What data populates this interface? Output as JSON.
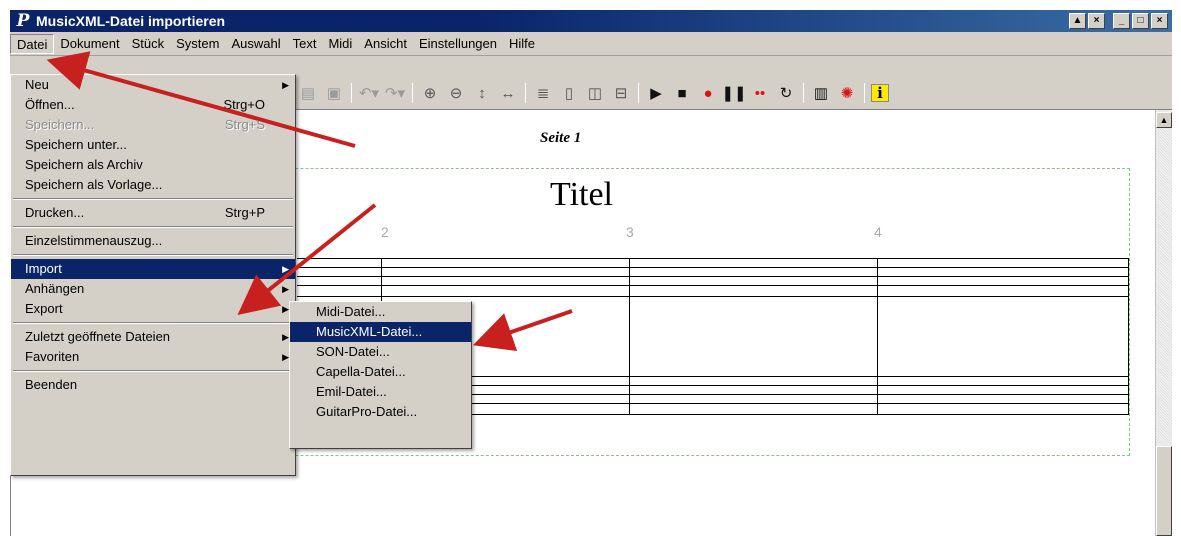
{
  "window": {
    "title": "MusicXML-Datei importieren",
    "app_icon": "P"
  },
  "menubar": {
    "items": [
      "Datei",
      "Dokument",
      "Stück",
      "System",
      "Auswahl",
      "Text",
      "Midi",
      "Ansicht",
      "Einstellungen",
      "Hilfe"
    ]
  },
  "toolbar": {
    "icons": [
      "paste-icon",
      "copy-icon",
      "undo-icon",
      "redo-icon",
      "zoom-in-icon",
      "zoom-out-icon",
      "fit-height-icon",
      "fit-width-icon",
      "list-view-icon",
      "page-view-icon",
      "two-page-view-icon",
      "split-view-icon",
      "play-icon",
      "stop-icon",
      "record-icon",
      "pause-icon",
      "step-record-icon",
      "loop-icon",
      "piano-icon",
      "metronome-icon",
      "info-icon"
    ]
  },
  "document": {
    "page_label": "Seite 1",
    "score_title": "Titel",
    "measures": [
      "2",
      "3",
      "4"
    ]
  },
  "file_menu": {
    "new": "Neu",
    "open": "Öffnen...",
    "open_shortcut": "Strg+O",
    "save": "Speichern...",
    "save_shortcut": "Strg+S",
    "save_as": "Speichern unter...",
    "save_archive": "Speichern als Archiv",
    "save_template": "Speichern als Vorlage...",
    "print": "Drucken...",
    "print_shortcut": "Strg+P",
    "extract_parts": "Einzelstimmenauszug...",
    "import": "Import",
    "append": "Anhängen",
    "export": "Export",
    "recent": "Zuletzt geöffnete Dateien",
    "favorites": "Favoriten",
    "exit": "Beenden"
  },
  "import_menu": {
    "items": [
      "Midi-Datei...",
      "MusicXML-Datei...",
      "SON-Datei...",
      "Capella-Datei...",
      "Emil-Datei...",
      "GuitarPro-Datei..."
    ],
    "selected": "MusicXML-Datei..."
  },
  "colors": {
    "highlight": "#0a246a",
    "annotation_arrow": "#c8201e",
    "page_border": "#7fc97f"
  }
}
